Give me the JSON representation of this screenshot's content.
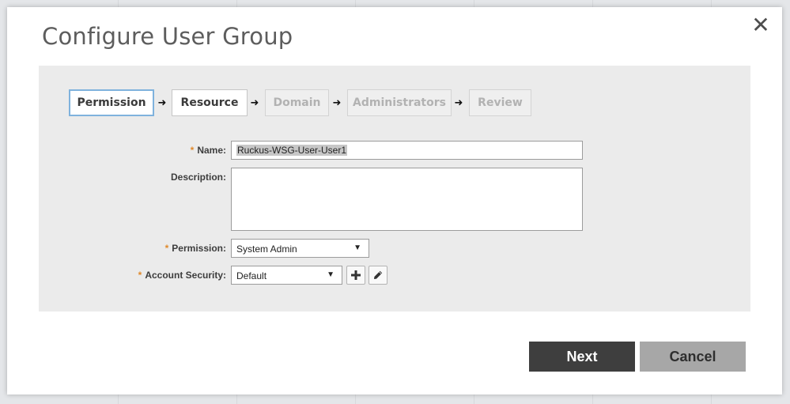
{
  "dialog": {
    "title": "Configure User Group",
    "close_symbol": "✕"
  },
  "wizard": {
    "steps": [
      {
        "label": "Permission",
        "state": "active"
      },
      {
        "label": "Resource",
        "state": "enabled"
      },
      {
        "label": "Domain",
        "state": "disabled"
      },
      {
        "label": "Administrators",
        "state": "disabled"
      },
      {
        "label": "Review",
        "state": "disabled"
      }
    ],
    "arrow_symbol": "➜"
  },
  "form": {
    "required_mark": "*",
    "name": {
      "label": "Name:",
      "value": "Ruckus-WSG-User-User1"
    },
    "description": {
      "label": "Description:",
      "value": ""
    },
    "permission": {
      "label": "Permission:",
      "selected": "System Admin"
    },
    "account_security": {
      "label": "Account Security:",
      "selected": "Default"
    }
  },
  "actions": {
    "next_label": "Next",
    "cancel_label": "Cancel"
  },
  "colors": {
    "active_step_border": "#7fb2dd",
    "required_mark": "#e08a2c",
    "next_bg": "#3e3e3e",
    "cancel_bg": "#a7a7a7"
  },
  "icons": {
    "add": "plus-icon",
    "edit": "pencil-icon",
    "dropdown": "caret-down-icon",
    "close": "close-icon",
    "step_arrow": "arrow-right-icon"
  }
}
